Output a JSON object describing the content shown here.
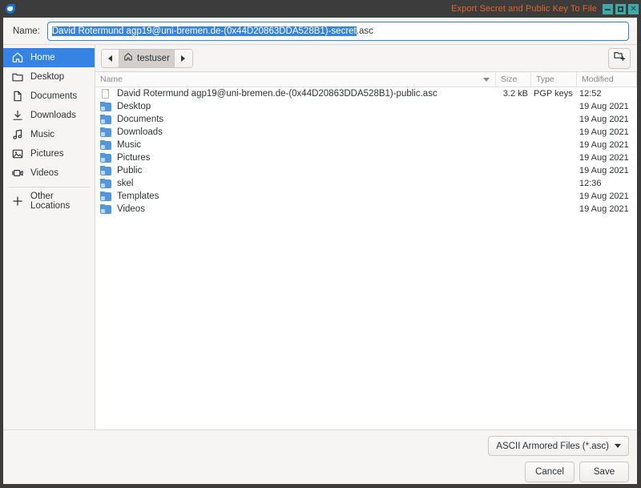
{
  "window": {
    "title": "Export Secret and Public Key To File",
    "app_icon": "water-drop-icon",
    "controls": {
      "minimize": "–",
      "maximize": "□",
      "close": "✕"
    }
  },
  "name_field": {
    "label": "Name:",
    "selected_text": "David Rotermund  agp19@uni-bremen.de-(0x44D20863DDA528B1)-secret",
    "unselected_text": ".asc",
    "full_value": "David Rotermund  agp19@uni-bremen.de-(0x44D20863DDA528B1)-secret.asc"
  },
  "sidebar": {
    "items": [
      {
        "label": "Home",
        "icon": "home-icon",
        "selected": true
      },
      {
        "label": "Desktop",
        "icon": "desktop-icon",
        "selected": false
      },
      {
        "label": "Documents",
        "icon": "document-icon",
        "selected": false
      },
      {
        "label": "Downloads",
        "icon": "download-icon",
        "selected": false
      },
      {
        "label": "Music",
        "icon": "music-icon",
        "selected": false
      },
      {
        "label": "Pictures",
        "icon": "picture-icon",
        "selected": false
      },
      {
        "label": "Videos",
        "icon": "video-icon",
        "selected": false
      }
    ],
    "other_locations": {
      "label": "Other Locations",
      "icon": "plus-icon"
    }
  },
  "pathbar": {
    "back": "◀",
    "forward": "▶",
    "current": "testuser",
    "current_icon": "home-icon",
    "new_folder_button": "create-folder-icon"
  },
  "columns": {
    "name": "Name",
    "size": "Size",
    "type": "Type",
    "modified": "Modified",
    "sort": "descending"
  },
  "files": [
    {
      "name": "David Rotermund  agp19@uni-bremen.de-(0x44D20863DDA528B1)-public.asc",
      "size": "3.2  kB",
      "type": "PGP keys",
      "modified": "12:52",
      "icon": "file-icon"
    },
    {
      "name": "Desktop",
      "size": "",
      "type": "",
      "modified": "19 Aug 2021",
      "icon": "folder-icon"
    },
    {
      "name": "Documents",
      "size": "",
      "type": "",
      "modified": "19 Aug 2021",
      "icon": "folder-icon"
    },
    {
      "name": "Downloads",
      "size": "",
      "type": "",
      "modified": "19 Aug 2021",
      "icon": "folder-icon"
    },
    {
      "name": "Music",
      "size": "",
      "type": "",
      "modified": "19 Aug 2021",
      "icon": "folder-icon"
    },
    {
      "name": "Pictures",
      "size": "",
      "type": "",
      "modified": "19 Aug 2021",
      "icon": "folder-icon"
    },
    {
      "name": "Public",
      "size": "",
      "type": "",
      "modified": "19 Aug 2021",
      "icon": "folder-icon"
    },
    {
      "name": "skel",
      "size": "",
      "type": "",
      "modified": "12:36",
      "icon": "folder-icon"
    },
    {
      "name": "Templates",
      "size": "",
      "type": "",
      "modified": "19 Aug 2021",
      "icon": "folder-icon"
    },
    {
      "name": "Videos",
      "size": "",
      "type": "",
      "modified": "19 Aug 2021",
      "icon": "folder-icon"
    }
  ],
  "footer": {
    "filter": "ASCII Armored Files (*.asc)",
    "cancel": "Cancel",
    "save": "Save"
  },
  "colors": {
    "titlebar_bg": "#3c3c3c",
    "title_text": "#e2642a",
    "window_button": "#3eaaa8",
    "accent_blue": "#3584e4",
    "chrome_bg": "#f6f5f4",
    "list_bg": "#ffffff"
  }
}
